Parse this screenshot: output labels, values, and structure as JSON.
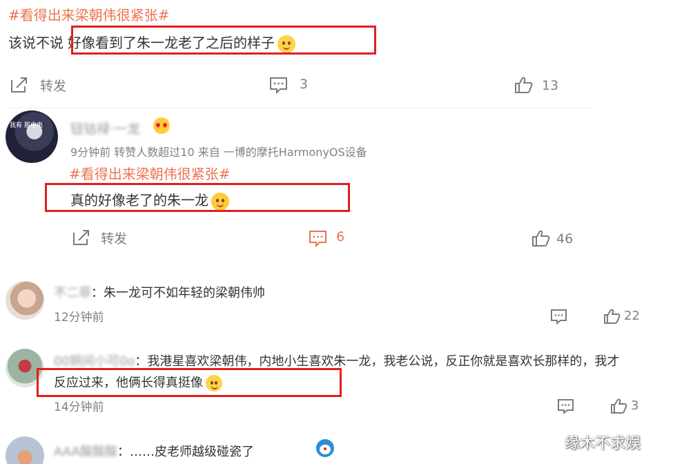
{
  "post": {
    "hashtag": "#看得出来梁朝伟很紧张#",
    "text_prefix": "该说不说",
    "text_highlight": "好像看到了朱一龙老了之后的样子",
    "emoji": "doge-emoji",
    "repost_label": "转发",
    "comment_count": "3",
    "like_count": "13"
  },
  "repost": {
    "username": "钮钴禄·一龙",
    "meta": "9分钟前 转赞人数超过10 来自 一博的摩托HarmonyOS设备",
    "avatar_text": "我有 那电电",
    "hashtag": "#看得出来梁朝伟很紧张#",
    "text": "真的好像老了的朱一龙",
    "emoji": "laugh-cry-emoji",
    "repost_label": "转发",
    "comment_count": "6",
    "like_count": "46"
  },
  "comments": [
    {
      "username": "不二菲",
      "text": "朱一龙可不如年轻的梁朝伟帅",
      "time": "12分钟前",
      "like_count": "22"
    },
    {
      "username": "00铜间小可0o",
      "text_line1": "我港星喜欢梁朝伟，内地小生喜欢朱一龙，我老公说，反正你就是喜欢长那样的，我才",
      "text_line2": "反应过来，他俩长得真挺像",
      "time": "14分钟前",
      "like_count": "3"
    },
    {
      "username": "AAA酸酸酸",
      "text": "……皮老师越级碰瓷了"
    }
  ],
  "watermark": "缘木不求娱",
  "colors": {
    "hashtag": "#eb7350",
    "highlight_box": "#e21d1d",
    "active_comment": "#eb7350",
    "meta": "#808080"
  }
}
